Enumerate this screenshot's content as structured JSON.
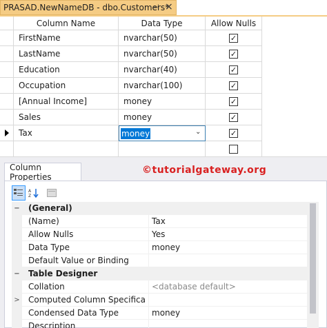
{
  "document_tab": {
    "title": "PRASAD.NewNameDB - dbo.Customers*",
    "pin_icon": "pin-icon",
    "close_icon": "close-icon"
  },
  "grid": {
    "headers": [
      "Column Name",
      "Data Type",
      "Allow Nulls"
    ],
    "rows": [
      {
        "name": "FirstName",
        "type": "nvarchar(50)",
        "allow_nulls": true
      },
      {
        "name": "LastName",
        "type": "nvarchar(50)",
        "allow_nulls": true
      },
      {
        "name": "Education",
        "type": "nvarchar(40)",
        "allow_nulls": true
      },
      {
        "name": "Occupation",
        "type": "nvarchar(100)",
        "allow_nulls": true
      },
      {
        "name": "[Annual Income]",
        "type": "money",
        "allow_nulls": true
      },
      {
        "name": "Sales",
        "type": "money",
        "allow_nulls": true
      },
      {
        "name": "Tax",
        "type": "money",
        "allow_nulls": true,
        "current": true,
        "editing": true
      },
      {
        "name": "",
        "type": "",
        "allow_nulls": false
      }
    ]
  },
  "properties": {
    "tab_label": "Column Properties",
    "watermark": "©tutorialgateway.org",
    "toolbar": [
      "categorized-icon",
      "alphabetical-icon",
      "property-pages-icon"
    ],
    "items": [
      {
        "kind": "category",
        "expander": "−",
        "name": "(General)",
        "value": ""
      },
      {
        "kind": "prop",
        "expander": "",
        "name": "(Name)",
        "value": "Tax"
      },
      {
        "kind": "prop",
        "expander": "",
        "name": "Allow Nulls",
        "value": "Yes"
      },
      {
        "kind": "prop",
        "expander": "",
        "name": "Data Type",
        "value": "money"
      },
      {
        "kind": "prop",
        "expander": "",
        "name": "Default Value or Binding",
        "value": ""
      },
      {
        "kind": "category",
        "expander": "−",
        "name": "Table Designer",
        "value": ""
      },
      {
        "kind": "prop",
        "expander": "",
        "name": "Collation",
        "value": "<database default>",
        "muted": true
      },
      {
        "kind": "prop",
        "expander": ">",
        "name": "Computed Column Specificatio",
        "value": ""
      },
      {
        "kind": "prop",
        "expander": "",
        "name": "Condensed Data Type",
        "value": "money"
      },
      {
        "kind": "prop",
        "expander": "",
        "name": "Description",
        "value": ""
      }
    ]
  }
}
